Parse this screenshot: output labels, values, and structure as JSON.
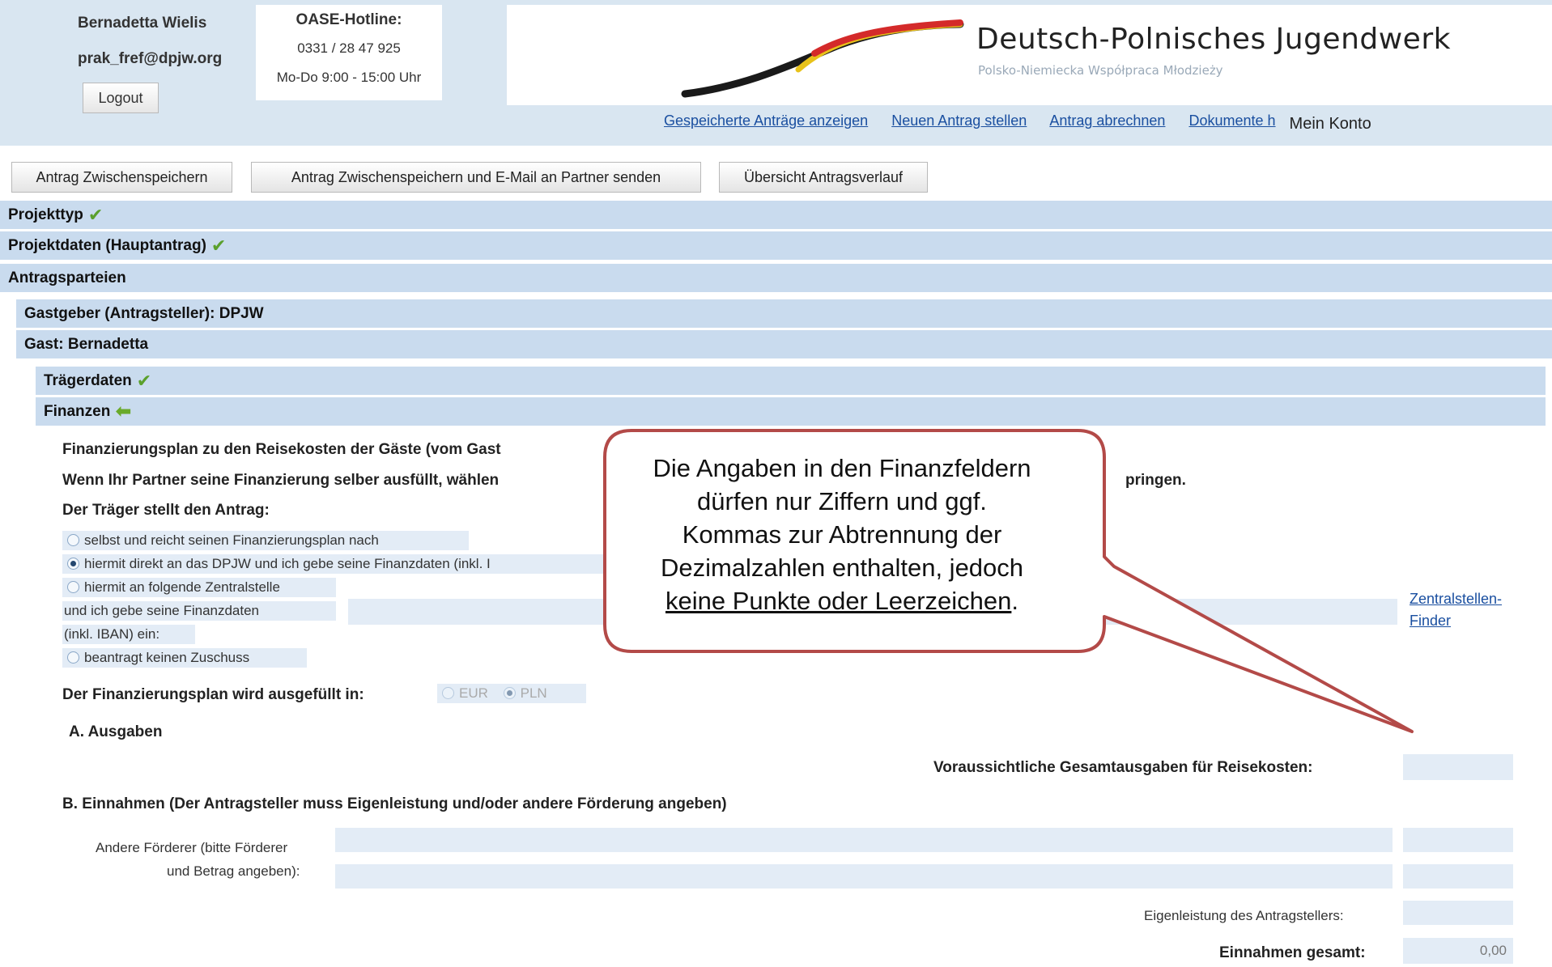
{
  "header": {
    "user_name": "Bernadetta Wielis",
    "user_email": "prak_fref@dpjw.org",
    "logout_label": "Logout",
    "hotline_title": "OASE-Hotline:",
    "hotline_phone": "0331 / 28 47 925",
    "hotline_hours": "Mo-Do 9:00 - 15:00 Uhr",
    "org_name": "Deutsch-Polnisches Jugendwerk",
    "org_subtitle": "Polsko-Niemiecka Współpraca Młodzieży",
    "nav": [
      "Gespeicherte Anträge anzeigen",
      "Neuen Antrag stellen",
      "Antrag abrechnen",
      "Dokumente h"
    ],
    "account_label": "Mein Konto"
  },
  "toolbar": {
    "save_label": "Antrag Zwischenspeichern",
    "save_email_label": "Antrag Zwischenspeichern und E-Mail an Partner senden",
    "overview_label": "Übersicht Antragsverlauf"
  },
  "sections": {
    "projekttyp": "Projekttyp",
    "projektdaten": "Projektdaten (Hauptantrag)",
    "antragsparteien": "Antragsparteien",
    "gastgeber": "Gastgeber (Antragsteller): DPJW",
    "gast": "Gast: Bernadetta",
    "traegerdaten": "Trägerdaten",
    "finanzen": "Finanzen"
  },
  "finance": {
    "plan_heading": "Finanzierungsplan zu den Reisekosten der Gäste (vom Gast",
    "partner_note_start": "Wenn Ihr Partner seine Finanzierung selber ausfüllt, wählen",
    "partner_note_end": "pringen.",
    "applicant_label": "Der Träger stellt den Antrag:",
    "options": [
      "selbst und reicht seinen Finanzierungsplan nach",
      "hiermit direkt an das DPJW und ich gebe seine Finanzdaten (inkl. I",
      "hiermit an folgende Zentralstelle",
      "beantragt keinen Zuschuss"
    ],
    "central_line2": "und ich gebe seine Finanzdaten",
    "central_line3": "(inkl. IBAN) ein:",
    "central_finder_line1": "Zentralstellen-",
    "central_finder_line2": "Finder",
    "currency_label": "Der Finanzierungsplan wird ausgefüllt in:",
    "currency_eur": "EUR",
    "currency_pln": "PLN",
    "expenses_heading": "A. Ausgaben",
    "expected_total_label": "Voraussichtliche Gesamtausgaben für Reisekosten:",
    "income_heading": "B. Einnahmen (Der Antragsteller muss Eigenleistung und/oder andere Förderung angeben)",
    "other_funders_line1": "Andere Förderer (bitte Förderer",
    "other_funders_line2": "und Betrag angeben):",
    "own_contribution_label": "Eigenleistung des Antragstellers:",
    "income_total_label": "Einnahmen gesamt:",
    "income_total_value": "0,00"
  },
  "callout": {
    "line1": "Die Angaben in den Finanzfeldern",
    "line2": "dürfen nur Ziffern und ggf.",
    "line3": "Kommas zur Abtrennung der",
    "line4": "Dezimalzahlen enthalten, jedoch",
    "line5_underlined": "keine Punkte oder Leerzeichen",
    "line5_end": "."
  },
  "colors": {
    "section_bar": "#c9dbee",
    "field_bg": "#e3ecf6",
    "link": "#1a4fa0",
    "callout_border": "#b34a48",
    "check": "#5aa02c"
  }
}
